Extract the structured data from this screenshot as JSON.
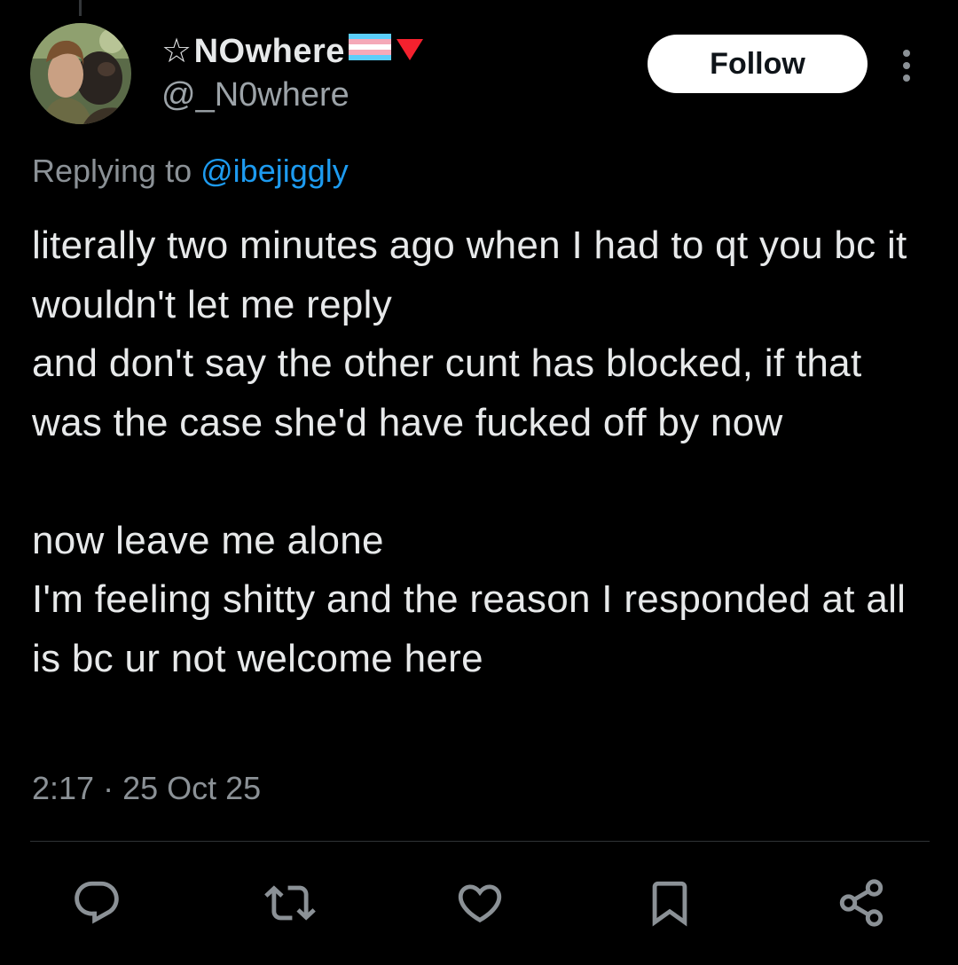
{
  "author": {
    "star": "☆",
    "display_name": "NOwhere",
    "handle": "@_N0where",
    "avatar": "avatar-photo"
  },
  "follow_label": "Follow",
  "reply": {
    "prefix": "Replying to",
    "mention": "@ibejiggly"
  },
  "tweet": {
    "paragraph_1": "literally two minutes ago when I had to qt you bc it wouldn't let me reply\nand don't say the other cunt has blocked, if that was the case she'd have fucked off by now",
    "paragraph_2": "now leave me alone\nI'm feeling shitty and the reason I responded at all is bc ur not welcome here"
  },
  "meta": {
    "time": "2:17",
    "separator": "·",
    "date": "25 Oct 25"
  },
  "actions": {
    "reply": "reply-icon",
    "retweet": "retweet-icon",
    "like": "heart-icon",
    "bookmark": "bookmark-icon",
    "share": "share-icon"
  },
  "colors": {
    "background": "#000000",
    "text": "#e7e9ea",
    "secondary": "#8b9196",
    "link": "#1d9bf0",
    "follow_bg": "#ffffff",
    "flag_blue": "#5BCEFA",
    "flag_pink": "#F5A9B8",
    "triangle_red": "#f4212e"
  }
}
